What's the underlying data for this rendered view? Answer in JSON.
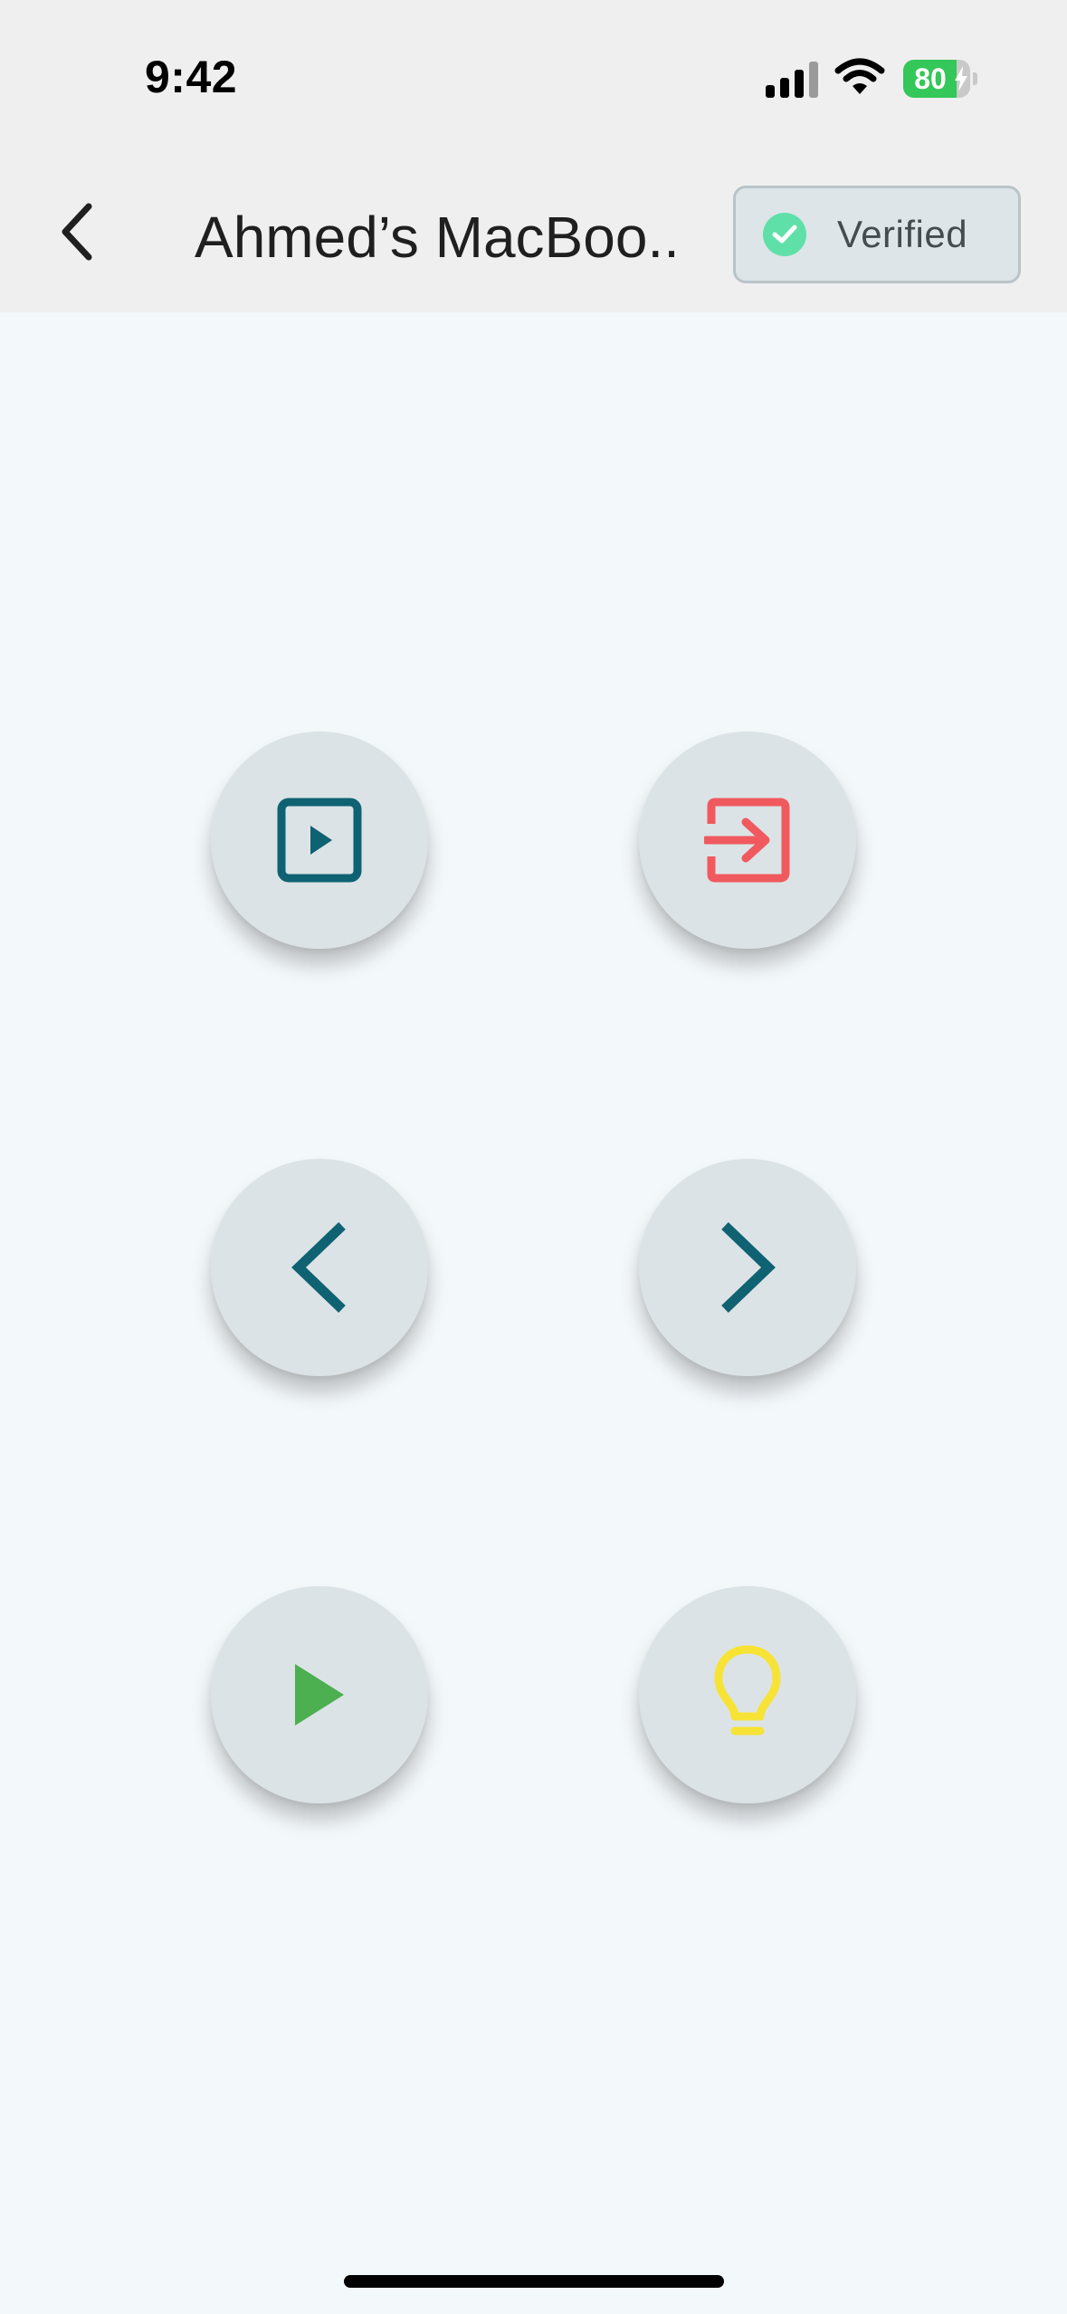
{
  "status_bar": {
    "time": "9:42",
    "battery_percent": "80",
    "battery_level": 0.8,
    "battery_color": "#34c759"
  },
  "header": {
    "back_icon": "chevron-left-icon",
    "title": "Ahmed’s MacBoo...",
    "badge": {
      "label": "Verified",
      "icon": "check-circle-icon",
      "icon_color": "#5fe0a8"
    }
  },
  "controls": [
    {
      "name": "start-presentation-button",
      "icon": "presentation-play-icon",
      "color": "#0f6272"
    },
    {
      "name": "exit-button",
      "icon": "exit-arrow-icon",
      "color": "#f05a5e"
    },
    {
      "name": "previous-button",
      "icon": "chevron-left-icon",
      "color": "#0f6272"
    },
    {
      "name": "next-button",
      "icon": "chevron-right-icon",
      "color": "#0f6272"
    },
    {
      "name": "play-button",
      "icon": "play-icon",
      "color": "#4caf50"
    },
    {
      "name": "light-button",
      "icon": "lightbulb-icon",
      "color": "#f7e335"
    }
  ]
}
